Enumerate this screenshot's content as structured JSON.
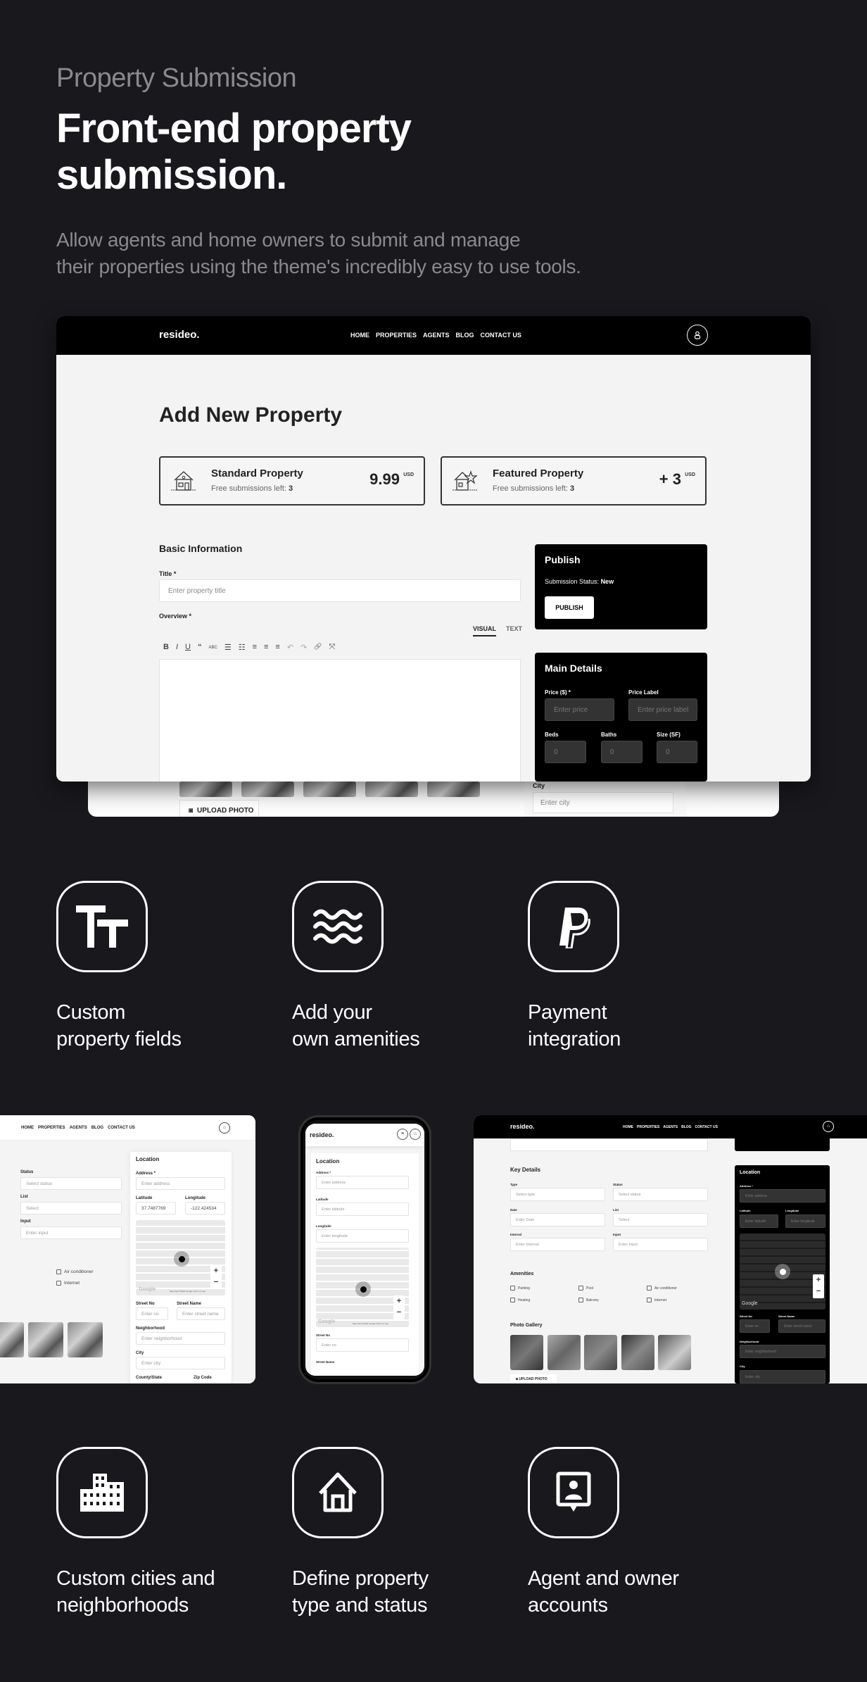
{
  "hero": {
    "eyebrow": "Property Submission",
    "title_line1": "Front-end property",
    "title_line2": "submission.",
    "lead_line1": "Allow agents and home owners to submit and manage",
    "lead_line2": "their properties using the theme's incredibly easy to use tools."
  },
  "site": {
    "logo": "resideo.",
    "nav": [
      "HOME",
      "PROPERTIES",
      "AGENTS",
      "BLOG",
      "CONTACT US"
    ],
    "user_icon": "user-icon",
    "menu_icon": "menu-icon"
  },
  "form": {
    "page_title": "Add New Property",
    "plans": [
      {
        "name": "Standard Property",
        "free_label": "Free submissions left:",
        "free_count": "3",
        "price": "9.99",
        "currency": "USD",
        "icon": "house-icon"
      },
      {
        "name": "Featured Property",
        "free_label": "Free submissions left:",
        "free_count": "3",
        "price": "+ 3",
        "currency": "USD",
        "icon": "house-star-icon"
      }
    ],
    "basic_info": {
      "title": "Basic Information",
      "title_label": "Title *",
      "title_placeholder": "Enter property title",
      "overview_label": "Overview *",
      "tabs": [
        "VISUAL",
        "TEXT"
      ],
      "active_tab": "VISUAL",
      "toolbar": [
        "B",
        "I",
        "U",
        "“",
        "ABC",
        "☰",
        "☷",
        "≡",
        "≡",
        "≡",
        "↶",
        "↷",
        "🔗",
        "⤧"
      ]
    },
    "publish": {
      "title": "Publish",
      "status_label": "Submission Status:",
      "status_value": "New",
      "button": "PUBLISH"
    },
    "main_details": {
      "title": "Main Details",
      "price_label": "Price ($) *",
      "price_placeholder": "Enter price",
      "price_label_label": "Price Label",
      "price_label_placeholder": "Enter price label",
      "beds_label": "Beds",
      "beds_value": "0",
      "baths_label": "Baths",
      "baths_value": "0",
      "size_label": "Size (SF)",
      "size_value": "0"
    },
    "back_card": {
      "upload_label": "UPLOAD PHOTO",
      "city_label": "City",
      "city_placeholder": "Enter city"
    }
  },
  "features_top": [
    {
      "icon": "text-size-icon",
      "line1": "Custom",
      "line2": "property fields"
    },
    {
      "icon": "waves-icon",
      "line1": "Add your",
      "line2": "own amenities"
    },
    {
      "icon": "paypal-icon",
      "line1": "Payment",
      "line2": "integration"
    }
  ],
  "shots": {
    "left": {
      "status_label": "Status",
      "status_value": "Select status",
      "list_label": "List",
      "list_value": "Select",
      "input_label": "Input",
      "input_placeholder": "Enter input",
      "amenities": [
        "Air conditioner",
        "Internet"
      ],
      "location_title": "Location",
      "address_label": "Address *",
      "address_placeholder": "Enter address",
      "lat_label": "Latitude",
      "lat_value": "37.7487769",
      "lng_label": "Longitude",
      "lng_value": "-122.424534",
      "street_no_label": "Street No",
      "street_no_placeholder": "Enter no",
      "street_name_label": "Street Name",
      "street_name_placeholder": "Enter street name",
      "neighborhood_label": "Neighborhood",
      "neighborhood_placeholder": "Enter neighborhood",
      "city_label": "City",
      "city_placeholder": "Enter city",
      "county_label": "County/State",
      "zip_label": "Zip Code",
      "map_brand": "Google",
      "map_attrib": "Map data ©2020 Google  Terms of Use"
    },
    "mobile": {
      "location_title": "Location",
      "address_label": "Address *",
      "address_placeholder": "Enter address",
      "lat_label": "Latitude",
      "lat_placeholder": "Enter latitude",
      "lng_label": "Longitude",
      "lng_placeholder": "Enter longitude",
      "street_no_label": "Street No",
      "street_no_placeholder": "Enter no",
      "street_name_label": "Street Name",
      "map_brand": "Google",
      "map_attrib": "Map data ©2020 Google  Terms of Use"
    },
    "right": {
      "key_details_title": "Key Details",
      "type_label": "Type",
      "type_value": "Select type",
      "status_label": "Status",
      "status_value": "Select status",
      "date_label": "Date",
      "date_placeholder": "Enter Date",
      "list_label": "List",
      "list_value": "Select",
      "interval_label": "Interval",
      "interval_placeholder": "Enter Interval",
      "input_label": "Input",
      "input_placeholder": "Enter Input",
      "amenities_title": "Amenities",
      "amenities": [
        "Parking",
        "Pool",
        "Air conditioner",
        "Heating",
        "Balcony",
        "Internet"
      ],
      "gallery_title": "Photo Gallery",
      "upload_label": "UPLOAD PHOTO",
      "location_title": "Location",
      "address_label": "Address *",
      "address_placeholder": "Enter address",
      "lat_label": "Latitude",
      "lat_placeholder": "Enter latitude",
      "lng_label": "Longitude",
      "lng_placeholder": "Enter longitude",
      "street_no_label": "Street No",
      "street_no_placeholder": "Enter no",
      "street_name_label": "Street Name",
      "street_name_placeholder": "Enter street name",
      "neighborhood_label": "Neighborhood",
      "neighborhood_placeholder": "Enter neighborhood",
      "city_label": "City",
      "city_placeholder": "Enter city",
      "map_brand": "Google"
    }
  },
  "features_bottom": [
    {
      "icon": "buildings-icon",
      "line1": "Custom cities and",
      "line2": "neighborhoods"
    },
    {
      "icon": "home-icon",
      "line1": "Define property",
      "line2": "type and status"
    },
    {
      "icon": "agent-badge-icon",
      "line1": "Agent and owner",
      "line2": "accounts"
    }
  ]
}
